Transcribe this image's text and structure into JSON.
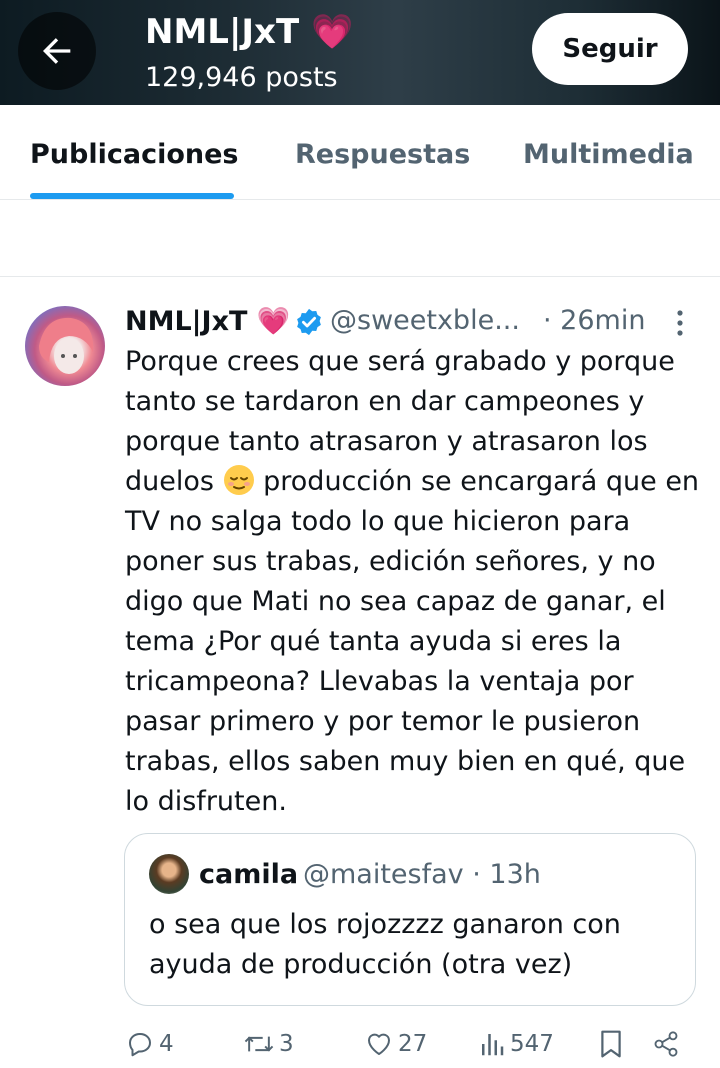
{
  "header": {
    "title": "NML|JxT 💗",
    "posts_count": "129,946 posts",
    "follow_label": "Seguir",
    "back_icon": "arrow-left-icon"
  },
  "tabs": [
    {
      "label": "Publicaciones",
      "active": true
    },
    {
      "label": "Respuestas",
      "active": false
    },
    {
      "label": "Multimedia",
      "active": false
    }
  ],
  "post": {
    "author_name": "NML|JxT 💗",
    "handle": "@sweetxble...",
    "time": "· 26min",
    "text_before_emoji": "Porque crees que será grabado y porque tanto se tardaron en dar campeones y porque tanto atrasaron y atrasaron los duelos",
    "emoji": "relieved-face",
    "text_after_emoji": "producción se encargará que en TV no salga todo lo que hicieron para poner sus trabas, edición señores, y no digo que Mati no sea capaz de ganar, el tema ¿Por qué tanta ayuda si eres la tricampeona? Llevabas la ventaja por pasar primero y por temor le pusieron trabas, ellos saben muy bien en qué, que lo disfruten.",
    "quote": {
      "name": "camila",
      "handle": "@maitesfav · 13h",
      "text": "o sea que los rojozzzz ganaron con ayuda de producción (otra vez)"
    },
    "actions": {
      "replies": "4",
      "reposts": "3",
      "likes": "27",
      "views": "547"
    }
  },
  "colors": {
    "accent": "#1d9bf0",
    "muted": "#536471",
    "text": "#0f1419"
  }
}
